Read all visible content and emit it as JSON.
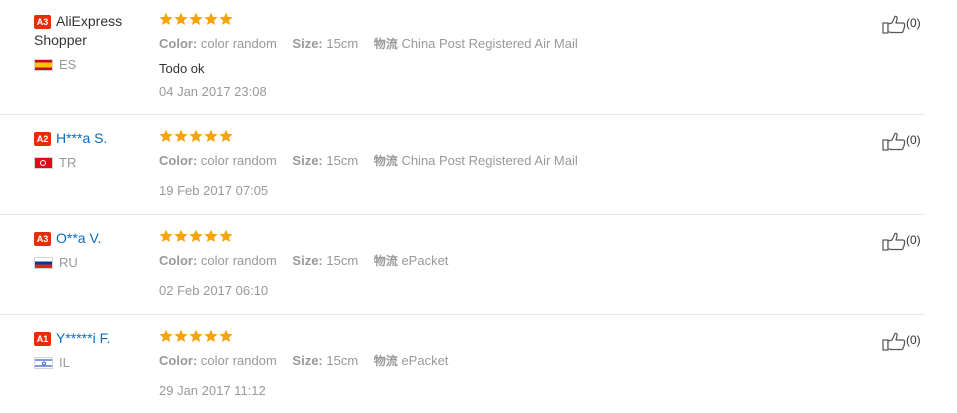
{
  "colors": {
    "star": "#f7a40a",
    "level_badge": "#e62e04",
    "link": "#0e6bbf",
    "meta": "#999999"
  },
  "labels": {
    "color": "Color:",
    "size": "Size:",
    "shipping": "物流"
  },
  "reviews": [
    {
      "level": "A3",
      "name": "AliExpress Shopper",
      "name_link": false,
      "country": "ES",
      "flag": "es-flag-icon",
      "rating": 5,
      "color_value": "color random",
      "size_value": "15cm",
      "shipping_value": "China Post Registered Air Mail",
      "feedback": "Todo ok",
      "date": "04 Jan 2017 23:08",
      "helpful": "(0)"
    },
    {
      "level": "A2",
      "name": "H***a S.",
      "name_link": true,
      "country": "TR",
      "flag": "tr-flag-icon",
      "rating": 5,
      "color_value": "color random",
      "size_value": "15cm",
      "shipping_value": "China Post Registered Air Mail",
      "feedback": "",
      "date": "19 Feb 2017 07:05",
      "helpful": "(0)"
    },
    {
      "level": "A3",
      "name": "O**a V.",
      "name_link": true,
      "country": "RU",
      "flag": "ru-flag-icon",
      "rating": 5,
      "color_value": "color random",
      "size_value": "15cm",
      "shipping_value": "ePacket",
      "feedback": "",
      "date": "02 Feb 2017 06:10",
      "helpful": "(0)"
    },
    {
      "level": "A1",
      "name": "Y*****i F.",
      "name_link": true,
      "country": "IL",
      "flag": "il-flag-icon",
      "rating": 5,
      "color_value": "color random",
      "size_value": "15cm",
      "shipping_value": "ePacket",
      "feedback": "",
      "date": "29 Jan 2017 11:12",
      "helpful": "(0)"
    }
  ]
}
